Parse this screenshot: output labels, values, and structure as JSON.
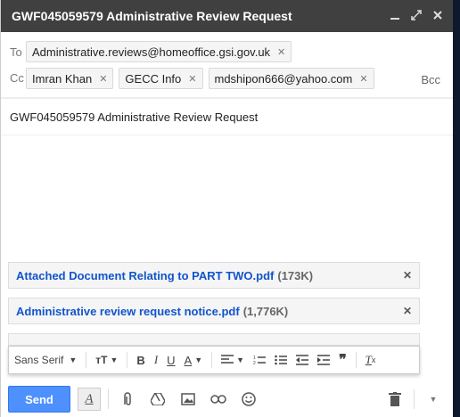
{
  "window": {
    "title": "GWF045059579 Administrative Review Request"
  },
  "recipients": {
    "to_label": "To",
    "cc_label": "Cc",
    "bcc_label": "Bcc",
    "to": [
      "Administrative.reviews@homeoffice.gsi.gov.uk"
    ],
    "cc": [
      "Imran Khan",
      "GECC Info",
      "mdshipon666@yahoo.com"
    ]
  },
  "subject": "GWF045059579 Administrative Review Request",
  "attachments": [
    {
      "name": "Attached Document Relating to PART TWO.pdf",
      "size": "(173K)"
    },
    {
      "name": "Administrative review request notice.pdf",
      "size": "(1,776K)"
    }
  ],
  "formatting": {
    "font": "Sans Serif"
  },
  "actions": {
    "send_label": "Send"
  }
}
